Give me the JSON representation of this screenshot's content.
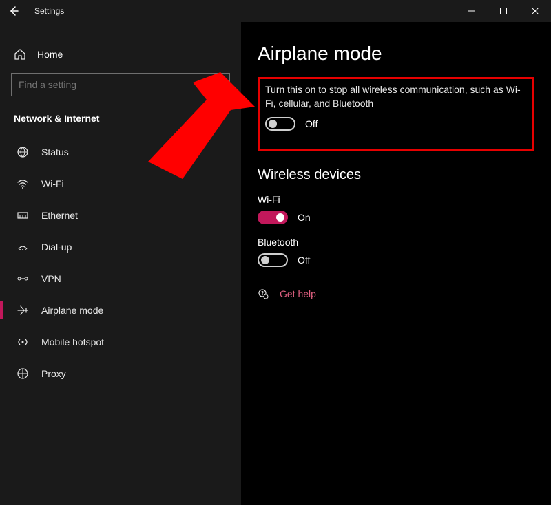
{
  "titlebar": {
    "title": "Settings"
  },
  "sidebar": {
    "home": "Home",
    "search_placeholder": "Find a setting",
    "category": "Network & Internet",
    "items": [
      {
        "label": "Status"
      },
      {
        "label": "Wi-Fi"
      },
      {
        "label": "Ethernet"
      },
      {
        "label": "Dial-up"
      },
      {
        "label": "VPN"
      },
      {
        "label": "Airplane mode"
      },
      {
        "label": "Mobile hotspot"
      },
      {
        "label": "Proxy"
      }
    ]
  },
  "main": {
    "title": "Airplane mode",
    "description": "Turn this on to stop all wireless communication, such as Wi-Fi, cellular, and Bluetooth",
    "airplane_toggle_state": "Off",
    "wireless_section": "Wireless devices",
    "wifi_label": "Wi-Fi",
    "wifi_state": "On",
    "bt_label": "Bluetooth",
    "bt_state": "Off",
    "help": "Get help"
  }
}
